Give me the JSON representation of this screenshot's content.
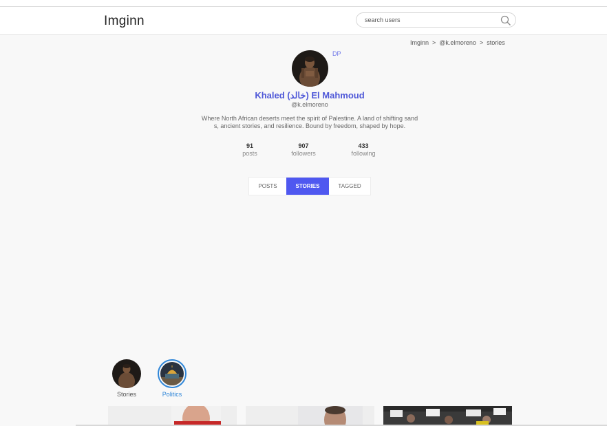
{
  "header": {
    "logo": "Imginn",
    "search_placeholder": "search users"
  },
  "breadcrumb": {
    "items": [
      "Imginn",
      "@k.elmoreno",
      "stories"
    ],
    "separator": ">"
  },
  "profile": {
    "dp_link": "DP",
    "full_name": "Khaled (خالد) El Mahmoud",
    "username": "@k.elmoreno",
    "bio": "Where North African deserts meet the spirit of Palestine. A land of shifting sands, ancient stories, and resilience. Bound by freedom, shaped by hope.",
    "stats": [
      {
        "value": "91",
        "label": "posts"
      },
      {
        "value": "907",
        "label": "followers"
      },
      {
        "value": "433",
        "label": "following"
      }
    ]
  },
  "tabs": [
    {
      "label": "POSTS",
      "active": false
    },
    {
      "label": "STORIES",
      "active": true
    },
    {
      "label": "TAGGED",
      "active": false
    }
  ],
  "highlights": [
    {
      "label": "Stories",
      "selected": false
    },
    {
      "label": "Politics",
      "selected": true
    }
  ],
  "colors": {
    "accent": "#4f58f0",
    "name": "#4f58d8",
    "highlight_selected": "#2f86d8"
  }
}
